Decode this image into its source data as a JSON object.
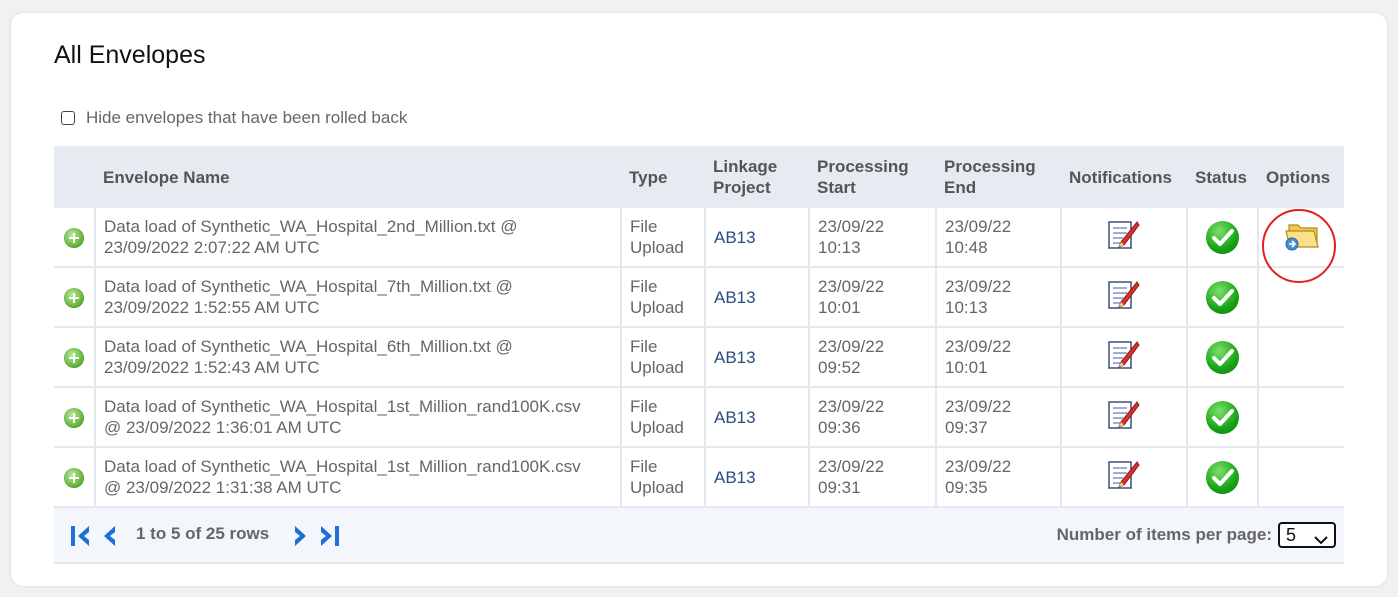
{
  "page": {
    "title": "All Envelopes"
  },
  "filter": {
    "hide_rolled_back_label": "Hide envelopes that have been rolled back",
    "checked": false
  },
  "table": {
    "headers": {
      "envelope_name": "Envelope Name",
      "type": "Type",
      "linkage_project_l1": "Linkage",
      "linkage_project_l2": "Project",
      "processing_start_l1": "Processing",
      "processing_start_l2": "Start",
      "processing_end_l1": "Processing",
      "processing_end_l2": "End",
      "notifications": "Notifications",
      "status": "Status",
      "options": "Options"
    },
    "rows": [
      {
        "name_l1": "Data load of Synthetic_WA_Hospital_2nd_Million.txt @",
        "name_l2": "23/09/2022 2:07:22 AM UTC",
        "type_l1": "File",
        "type_l2": "Upload",
        "project": "AB13",
        "start_l1": "23/09/22",
        "start_l2": "10:13",
        "end_l1": "23/09/22",
        "end_l2": "10:48"
      },
      {
        "name_l1": "Data load of Synthetic_WA_Hospital_7th_Million.txt @",
        "name_l2": "23/09/2022 1:52:55 AM UTC",
        "type_l1": "File",
        "type_l2": "Upload",
        "project": "AB13",
        "start_l1": "23/09/22",
        "start_l2": "10:01",
        "end_l1": "23/09/22",
        "end_l2": "10:13"
      },
      {
        "name_l1": "Data load of Synthetic_WA_Hospital_6th_Million.txt @",
        "name_l2": "23/09/2022 1:52:43 AM UTC",
        "type_l1": "File",
        "type_l2": "Upload",
        "project": "AB13",
        "start_l1": "23/09/22",
        "start_l2": "09:52",
        "end_l1": "23/09/22",
        "end_l2": "10:01"
      },
      {
        "name_l1": "Data load of Synthetic_WA_Hospital_1st_Million_rand100K.csv",
        "name_l2": "@ 23/09/2022 1:36:01 AM UTC",
        "type_l1": "File",
        "type_l2": "Upload",
        "project": "AB13",
        "start_l1": "23/09/22",
        "start_l2": "09:36",
        "end_l1": "23/09/22",
        "end_l2": "09:37"
      },
      {
        "name_l1": "Data load of Synthetic_WA_Hospital_1st_Million_rand100K.csv",
        "name_l2": "@ 23/09/2022 1:31:38 AM UTC",
        "type_l1": "File",
        "type_l2": "Upload",
        "project": "AB13",
        "start_l1": "23/09/22",
        "start_l2": "09:31",
        "end_l1": "23/09/22",
        "end_l2": "09:35"
      }
    ]
  },
  "pager": {
    "range": "1 to 5 of 25 rows",
    "per_page_label": "Number of items per page:",
    "per_page_value": "5"
  },
  "icons": {
    "expand": "expand-plus-icon",
    "notifications": "notification-edit-icon",
    "status": "status-check-icon",
    "options": "folder-options-icon",
    "first": "first-page-icon",
    "prev": "previous-page-icon",
    "next": "next-page-icon",
    "last": "last-page-icon"
  },
  "colors": {
    "accent": "#1e6fd9",
    "status_ok": "#16a316",
    "highlight": "#e02020",
    "header_bg": "#e6ebf1"
  }
}
